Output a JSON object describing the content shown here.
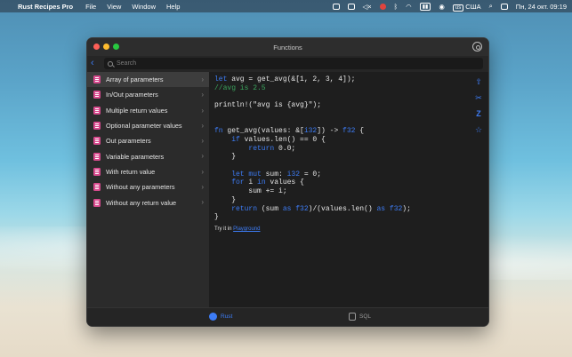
{
  "menubar": {
    "app_name": "Rust Recipes Pro",
    "menus": [
      "File",
      "View",
      "Window",
      "Help"
    ],
    "keyboard_layout": "США",
    "datetime": "Пн, 24 окт.  09:19"
  },
  "window": {
    "title": "Functions",
    "search_placeholder": "Search"
  },
  "sidebar": {
    "items": [
      {
        "label": "Array of parameters",
        "selected": true
      },
      {
        "label": "In/Out parameters"
      },
      {
        "label": "Multiple return values"
      },
      {
        "label": "Optional parameter values"
      },
      {
        "label": "Out parameters"
      },
      {
        "label": "Variable parameters"
      },
      {
        "label": "With return value"
      },
      {
        "label": "Without any parameters"
      },
      {
        "label": "Without any return value"
      }
    ]
  },
  "code": {
    "try_it_text": "Try it in ",
    "try_it_link": "Playground"
  },
  "tabs": {
    "rust_label": "Rust",
    "sql_label": "SQL"
  },
  "colors": {
    "accent": "#3d7cf5",
    "item_icon": "#d84a8e",
    "comment": "#3ba55d"
  }
}
